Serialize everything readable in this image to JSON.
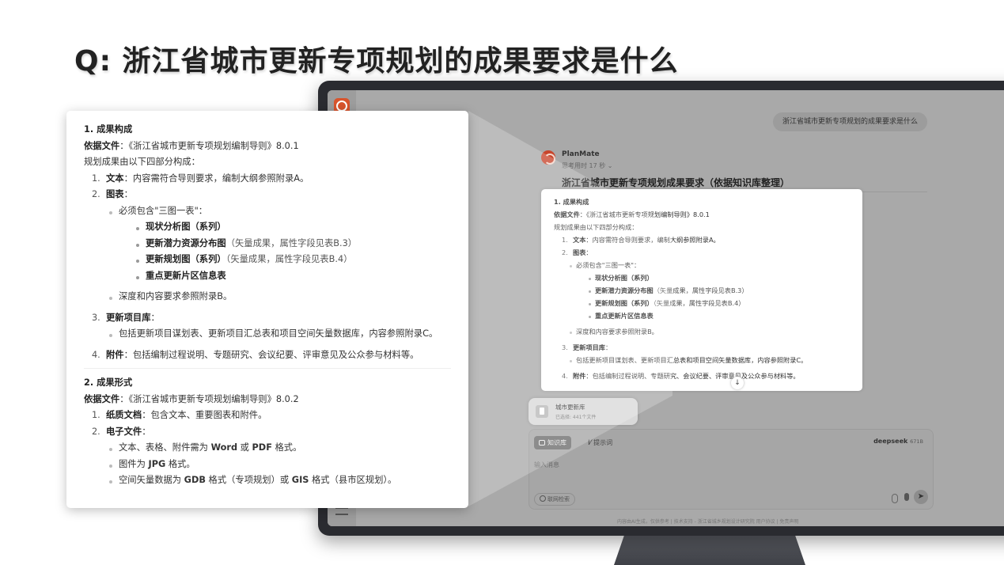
{
  "slide": {
    "title": "Q: 浙江省城市更新专项规划的成果要求是什么"
  },
  "app": {
    "user_message": "浙江省城市更新专项规划的成果要求是什么",
    "bot": {
      "name": "PlanMate",
      "thinking": "思考用时 17 秒 ⌄",
      "heading": "浙江省城市更新专项规划成果要求（依据知识库整理）"
    },
    "knowledge_chip": {
      "title": "城市更新库",
      "subtitle": "已选择: 441个文件"
    },
    "composer": {
      "kb_button": "知识库",
      "prompt_button": "提示词",
      "model": "deepseek",
      "model_version": "671B",
      "input_placeholder": "输入消息",
      "web_search": "联网检索",
      "send_icon": "send-icon"
    },
    "footer": "内容由AI生成，仅供参考 | 技术支持 - 浙江省城乡规划设计研究院 用户协议 | 免责声明",
    "scroll_icon": "↓"
  },
  "answer": {
    "s1": {
      "title": "1. 成果构成",
      "basis_label": "依据文件",
      "basis_text": "：《浙江省城市更新专项规划编制导则》8.0.1",
      "intro": "规划成果由以下四部分构成：",
      "items": {
        "text": {
          "num": "1.",
          "label": "文本",
          "desc": "：内容需符合导则要求，编制大纲参照附录A。"
        },
        "charts": {
          "num": "2.",
          "label": "图表",
          "desc": "："
        },
        "charts_must": "必须包含\"三图一表\"：",
        "chart_list": [
          {
            "name": "现状分析图（系列）",
            "desc": ""
          },
          {
            "name": "更新潜力资源分布图",
            "desc": "（矢量成果，属性字段见表B.3）"
          },
          {
            "name": "更新规划图（系列）",
            "desc": "（矢量成果，属性字段见表B.4）"
          },
          {
            "name": "重点更新片区信息表",
            "desc": ""
          }
        ],
        "charts_depth": "深度和内容要求参照附录B。",
        "projects": {
          "num": "3.",
          "label": "更新项目库",
          "desc": "："
        },
        "projects_desc": "包括更新项目谋划表、更新项目汇总表和项目空间矢量数据库，内容参照附录C。",
        "attach": {
          "num": "4.",
          "label": "附件",
          "desc": "：包括编制过程说明、专题研究、会议纪要、评审意见及公众参与材料等。"
        }
      }
    },
    "s2": {
      "title": "2. 成果形式",
      "basis_label": "依据文件",
      "basis_text": "：《浙江省城市更新专项规划编制导则》8.0.2",
      "paper": {
        "num": "1.",
        "label": "纸质文档",
        "desc": "：包含文本、重要图表和附件。"
      },
      "electronic": {
        "num": "2.",
        "label": "电子文件",
        "desc": "："
      },
      "e1_pre": "文本、表格、附件需为 ",
      "e1_word": "Word",
      "e1_mid": " 或 ",
      "e1_pdf": "PDF",
      "e1_post": " 格式。",
      "e2_pre": "图件为 ",
      "e2_jpg": "JPG",
      "e2_post": " 格式。",
      "e3_pre": "空间矢量数据为 ",
      "e3_gdb": "GDB",
      "e3_mid": " 格式（专项规划）或 ",
      "e3_gis": "GIS",
      "e3_post": " 格式（县市区规划）。"
    }
  }
}
